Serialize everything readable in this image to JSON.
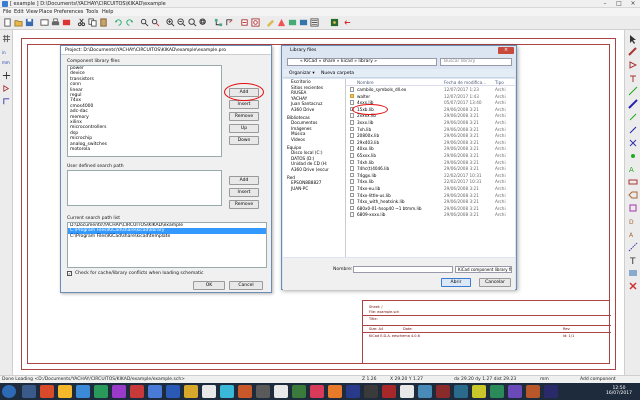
{
  "window": {
    "title": "[ example ] D:\\Documents\\YACHAY\\CIRCUITOS\\KIKAD\\example"
  },
  "menu": [
    "File",
    "Edit",
    "View",
    "Place",
    "Preferences",
    "Tools",
    "Help"
  ],
  "project_dialog": {
    "title": "Project: D:\\Documents\\YACHAY\\CIRCUITOS\\KIKAD\\example\\example.pro",
    "component_files_label": "Component library files",
    "component_files": [
      "power",
      "device",
      "transistors",
      "conn",
      "linear",
      "regul",
      "74xx",
      "cmos4000",
      "adc-dac",
      "memory",
      "xilinx",
      "microcontrollers",
      "dsp",
      "microchip",
      "analog_switches",
      "motorola"
    ],
    "buttons_top": [
      "Add",
      "Insert",
      "Remove",
      "Up",
      "Down"
    ],
    "user_path_label": "User defined search path",
    "buttons_bottom": [
      "Add",
      "Insert",
      "Remove"
    ],
    "current_path_label": "Current search path list",
    "current_paths": [
      "D:\\Documents\\YACHAY\\CIRCUITOS\\KIKAD\\example",
      "C:\\Program Files\\KiCad\\share\\kicad\\library",
      "C:\\Program Files\\KiCad\\share\\kicad\\template"
    ],
    "checkbox_label": "Check for cache/library conflicts when loading schematic",
    "checkbox_mark": "✓",
    "ok": "OK",
    "cancel": "Cancel"
  },
  "library_dialog": {
    "title": "Library files",
    "address": "« KiCad » share » kicad » library »",
    "search_placeholder": "Buscar library",
    "organize": "Organizar ▾",
    "new_folder": "Nueva carpeta",
    "nav_items": [
      {
        "label": "Escritorio",
        "group": false
      },
      {
        "label": "Sitios recientes",
        "group": false
      },
      {
        "label": "RIUSEA",
        "group": false
      },
      {
        "label": "YACHAY",
        "group": false
      },
      {
        "label": "Juan Santacruz",
        "group": false
      },
      {
        "label": "A360 Drive",
        "group": false
      },
      {
        "label": "Bibliotecas",
        "group": true
      },
      {
        "label": "Documentos",
        "group": false
      },
      {
        "label": "Imágenes",
        "group": false
      },
      {
        "label": "Música",
        "group": false
      },
      {
        "label": "Vídeos",
        "group": false
      },
      {
        "label": "Equipo",
        "group": true
      },
      {
        "label": "Disco local (C:)",
        "group": false
      },
      {
        "label": "DATOS (D:)",
        "group": false
      },
      {
        "label": "Unidad de CD (H:",
        "group": false
      },
      {
        "label": "A360 Drive (escur",
        "group": false
      },
      {
        "label": "Red",
        "group": true
      },
      {
        "label": "EPSON8B8827",
        "group": false
      },
      {
        "label": "JUAN-PC",
        "group": false
      }
    ],
    "columns": [
      "Nombre",
      "Fecha de modifica...",
      "Tipo"
    ],
    "files": [
      {
        "name": "cambilo_symbols_dll.ex",
        "date": "12/07/2017 1:23",
        "type": "Archi",
        "folder": false
      },
      {
        "name": "walter",
        "date": "12/07/2017 1:43",
        "type": "Archi",
        "folder": true
      },
      {
        "name": "4xxx.lib",
        "date": "05/07/2017 13:40",
        "type": "Archi",
        "folder": false
      },
      {
        "name": "15xb.lib",
        "date": "29/06/2008 3:21",
        "type": "Archi",
        "folder": false
      },
      {
        "name": "2xxxx.lib",
        "date": "29/06/2008 3:21",
        "type": "Archi",
        "folder": false
      },
      {
        "name": "3xxx.lib",
        "date": "29/06/2008 3:21",
        "type": "Archi",
        "folder": false
      },
      {
        "name": "7xh.lib",
        "date": "29/06/2008 3:21",
        "type": "Archi",
        "folder": false
      },
      {
        "name": "20800x.lib",
        "date": "29/06/2008 3:21",
        "type": "Archi",
        "folder": false
      },
      {
        "name": "29x403.lib",
        "date": "29/06/2008 3:21",
        "type": "Archi",
        "folder": false
      },
      {
        "name": "40xx.lib",
        "date": "29/06/2008 3:21",
        "type": "Archi",
        "folder": false
      },
      {
        "name": "65xxx.lib",
        "date": "29/06/2008 3:21",
        "type": "Archi",
        "folder": false
      },
      {
        "name": "74xh.lib",
        "date": "29/06/2008 3:21",
        "type": "Archi",
        "folder": false
      },
      {
        "name": "74hc(t)4046.lib",
        "date": "29/06/2008 3:21",
        "type": "Archi",
        "folder": false
      },
      {
        "name": "74ggx.lib",
        "date": "22/02/2017 10:31",
        "type": "Archi",
        "folder": false
      },
      {
        "name": "74xx.lib",
        "date": "22/02/2017 10:31",
        "type": "Archi",
        "folder": false
      },
      {
        "name": "74xx-eu.lib",
        "date": "29/06/2008 3:21",
        "type": "Archi",
        "folder": false
      },
      {
        "name": "74xx-little-us.lib",
        "date": "29/06/2008 3:21",
        "type": "Archi",
        "folder": false
      },
      {
        "name": "74xx_with_heatsink.lib",
        "date": "29/06/2008 3:21",
        "type": "Archi",
        "folder": false
      },
      {
        "name": "680x0-01-hsop40 ~1 btmm.lib",
        "date": "29/06/2008 3:21",
        "type": "Archi",
        "folder": false
      },
      {
        "name": "6809-xxxx.lib",
        "date": "29/06/2008 3:21",
        "type": "Archi",
        "folder": false
      }
    ],
    "name_label": "Nombre:",
    "file_type": "KiCad component library file (*",
    "open": "Abrir",
    "cancel": "Cancelar"
  },
  "title_block": {
    "sheet": "Sheet: /",
    "file": "File: example.sch",
    "title_label": "Title:",
    "size": "Size: A4",
    "date": "Date:",
    "rev": "Rev:",
    "kicad": "KiCad E.D.A. eeschema 4.0.6",
    "id": "Id: 1/1"
  },
  "status": {
    "left": "Done Loading <D:/Documents/YACHAY/CIRCUITOS/KIKAD/example/example.sch>",
    "zoom": "Z 1.26",
    "coords": "X 29.20  Y 1.27",
    "delta": "dx 29.20  dy 1.27  dist 29.23",
    "units": "mm",
    "mode": "Add component"
  },
  "clock": {
    "time": "12:50",
    "date": "16/07/2017"
  },
  "colors": {
    "accent": "#3399ff",
    "highlight_circle": "#e01010",
    "taskbar": "#1e2b3c"
  }
}
